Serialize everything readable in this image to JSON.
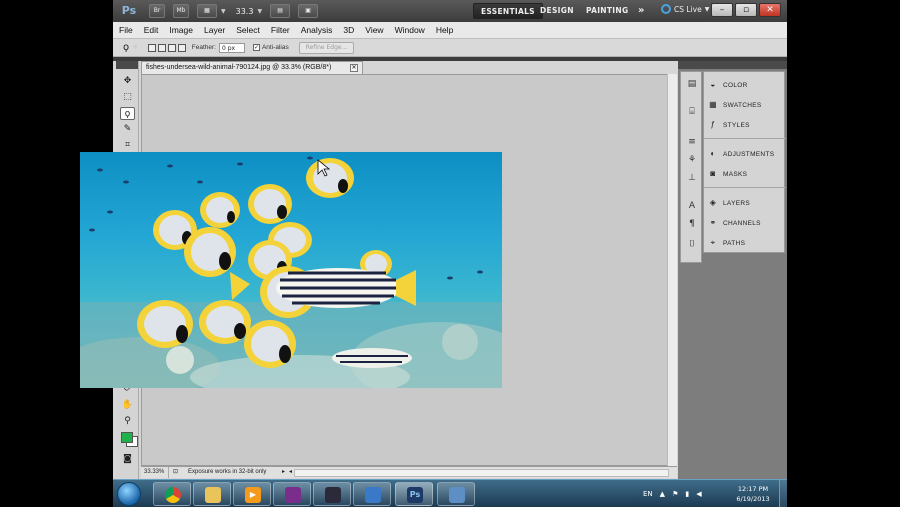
{
  "appbar": {
    "logo": "Ps",
    "br": "Br",
    "mb": "Mb",
    "zoom": "33.3",
    "workspaces": [
      "ESSENTIALS",
      "DESIGN",
      "PAINTING"
    ],
    "more": "»",
    "cs_live": "CS Live",
    "minimize": "–",
    "restore": "▫",
    "close": "✕"
  },
  "menu": [
    "File",
    "Edit",
    "Image",
    "Layer",
    "Select",
    "Filter",
    "Analysis",
    "3D",
    "View",
    "Window",
    "Help"
  ],
  "options": {
    "feather_label": "Feather:",
    "feather_value": "0 px",
    "antialias_label": "Anti-alias",
    "refine_edge": "Refine Edge..."
  },
  "document": {
    "tab_title": "fishes-undersea-wild-animal-790124.jpg @ 33.3% (RGB/8*)",
    "close": "✕"
  },
  "status": {
    "zoom": "33.33%",
    "info": "Exposure works in 32-bit only"
  },
  "panels": {
    "group1": [
      "COLOR",
      "SWATCHES",
      "STYLES"
    ],
    "group2": [
      "ADJUSTMENTS",
      "MASKS"
    ],
    "group3": [
      "LAYERS",
      "CHANNELS",
      "PATHS"
    ]
  },
  "taskbar": {
    "lang": "EN",
    "time": "12:17 PM",
    "date": "6/19/2013"
  },
  "colors": {
    "foreground": "#1fb14b",
    "background": "#ffffff"
  }
}
